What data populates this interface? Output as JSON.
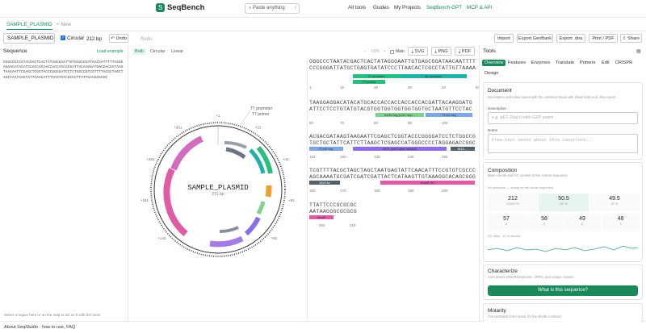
{
  "app": {
    "logo": "S",
    "name": "SeqBench"
  },
  "search": {
    "placeholder": "Paste anything",
    "shortcut": "/"
  },
  "nav": [
    "All tools",
    "Guides",
    "My Projects",
    "SeqBench-GPT",
    "MCP & API"
  ],
  "file_tabs": {
    "current": "SAMPLE_PLASMID",
    "new": "+ New"
  },
  "toolbar": {
    "name": "SAMPLE_PLASMID",
    "circular_label": "Circular",
    "length": "212 bp",
    "undo": "Undo",
    "redo": "Redo",
    "import": "Import",
    "export_genbank": "Export GenBank",
    "export_dna": "Export .dna",
    "print": "Print / PDF",
    "share": "Share"
  },
  "left": {
    "title": "Sequence",
    "load_example": "Load example",
    "sequence": "GGGCCCTAATACGACTCACTATAGGGAATTGTGAGCGGATAACAATTTTTAAGGAGGACATACATGCACCACCACCACCACCACGATTACAAGGATGACGACGATAAGTAAGAATTCGAGCTCGGTACCCGGGGATCCTCTGGCCGTCGTTTTACGCTAGCTAGCTAATGAGTATTCAACATTTCCGTGTCGCCCTTATTCCCGCGCGC",
    "hint": "Select a region here or on the map to act on it with the tools."
  },
  "view": {
    "modes": [
      "Both",
      "Circular",
      "Linear"
    ],
    "zoom": "60%",
    "main_label": "Main",
    "export_svg": "SVG",
    "export_png": "PNG",
    "export_pdf": "PDF"
  },
  "map": {
    "name": "SAMPLE_PLASMID",
    "length": "212 bp",
    "callouts": [
      "T7 promoter",
      "T7 primer"
    ],
    "ring_ticks": [
      "1",
      "21",
      "41",
      "61",
      "81",
      "101",
      "121",
      "141",
      "161",
      "181",
      "201"
    ]
  },
  "linear": {
    "rows": [
      {
        "seq": "GGGCCCTAATACGACTCACTATAGGGAATTGTGAGCGGATAACAATTTT",
        "comp": "CCCGGGATTATGCTGAGTGATATCCCTTAACACTCGCCTATTGTTAAAA",
        "ticks": [
          "1",
          "10",
          "20",
          "30",
          "40",
          "50"
        ],
        "features": [
          {
            "label": "T7 promoter"
          },
          {
            "label": "lac operator"
          },
          {
            "label": "T7 primer"
          }
        ]
      },
      {
        "seq": "TAAGGAGGACATACATGCACCACCACCACCACCACGATTACAAGGATG",
        "comp": "ATTCCTCCTGTATGTACGTGGTGGTGGTGGTGGTGCTAATGTTCCTAC",
        "ticks": [
          "60",
          "70",
          "80",
          "90",
          "100"
        ],
        "features": [
          {
            "label": "6xHis tag (LAC sup..."
          },
          {
            "label": "FLAG tag"
          }
        ]
      },
      {
        "seq": "ACGACGATAAGTAAGAATTCGAGCTCGGTACCCGGGGATCCTCTGGCCG",
        "comp": "TGCTGCTATTCATTCTTAAGCTCGAGCCATGGGCCCCTAGGAGACCGGC",
        "ticks": [
          "110",
          "120",
          "130",
          "140",
          "150"
        ],
        "features": [
          {
            "label": "FLAG tag"
          },
          {
            "label": "MCS (poC-style cluster)"
          },
          {
            "label": "M13 ..."
          }
        ]
      },
      {
        "seq": "TCGTTTTACGCTAGCTAGCTAATGAGTATTCAACATTTCCGTGTCGCCC",
        "comp": "AGCAAAATGCGATCGATCGATTACTCATAAGTTGTAAAGGCACAGCGGG",
        "ticks": [
          "160",
          "170",
          "180",
          "190",
          "200"
        ],
        "features": [
          {
            "label": "M13 fw"
          },
          {
            "label": "AmpR (5')"
          }
        ]
      },
      {
        "seq": "TTATTCCCGCGCGC",
        "comp": "AATAAGGGCGCGCG",
        "ticks": [
          "200",
          "210"
        ],
        "features": [
          {
            "label": "AmpR"
          }
        ]
      }
    ]
  },
  "tools": {
    "title": "Tools",
    "tabs": [
      "Overview",
      "Features",
      "Enzymes",
      "Translate",
      "Primers",
      "Edit",
      "CRISPR",
      "Design"
    ],
    "document": {
      "title": "Document",
      "subtitle": "Description and notes saved with the construct travel with share links and .dna export.",
      "desc_label": "Description",
      "desc_placeholder": "e.g. pET-28a(+) with GFP insert",
      "notes_label": "Notes",
      "notes_placeholder": "Free-text notes about this construct..."
    },
    "composition": {
      "title": "Composition",
      "subtitle": "Base counts and GC content of the current sequence.",
      "selection_note": "No selection — acting on the whole sequence.",
      "stats": [
        {
          "value": "212",
          "label": "LENGTH"
        },
        {
          "value": "50.5",
          "label": "GC %"
        },
        {
          "value": "49.5",
          "label": "AT %"
        },
        {
          "value": "57",
          "label": "A"
        },
        {
          "value": "58",
          "label": "C"
        },
        {
          "value": "49",
          "label": "G"
        },
        {
          "value": "48",
          "label": "T"
        }
      ],
      "plot_caption": "GC track · 10 nt window"
    },
    "characterize": {
      "title": "Characterize",
      "subtitle": "Auto-detect DNA/RNA/protein, ORFs, and unique codons.",
      "button": "What is this sequence?"
    },
    "molarity": {
      "title": "Molarity",
      "subtitle": "Concentration from mass, for the whole construct."
    }
  },
  "footer": {
    "about": "About SeqStudio · how to use, FAQ"
  },
  "colors": {
    "accent": "#1a8a5a",
    "promoter": "#2bbd7e",
    "operator": "#20b0a8",
    "his": "#7fd18b",
    "flag": "#7da7ea",
    "mcs": "#8b6ee8",
    "m13": "#555f6b",
    "ampr": "#e05aa6",
    "orange": "#f0a030"
  }
}
